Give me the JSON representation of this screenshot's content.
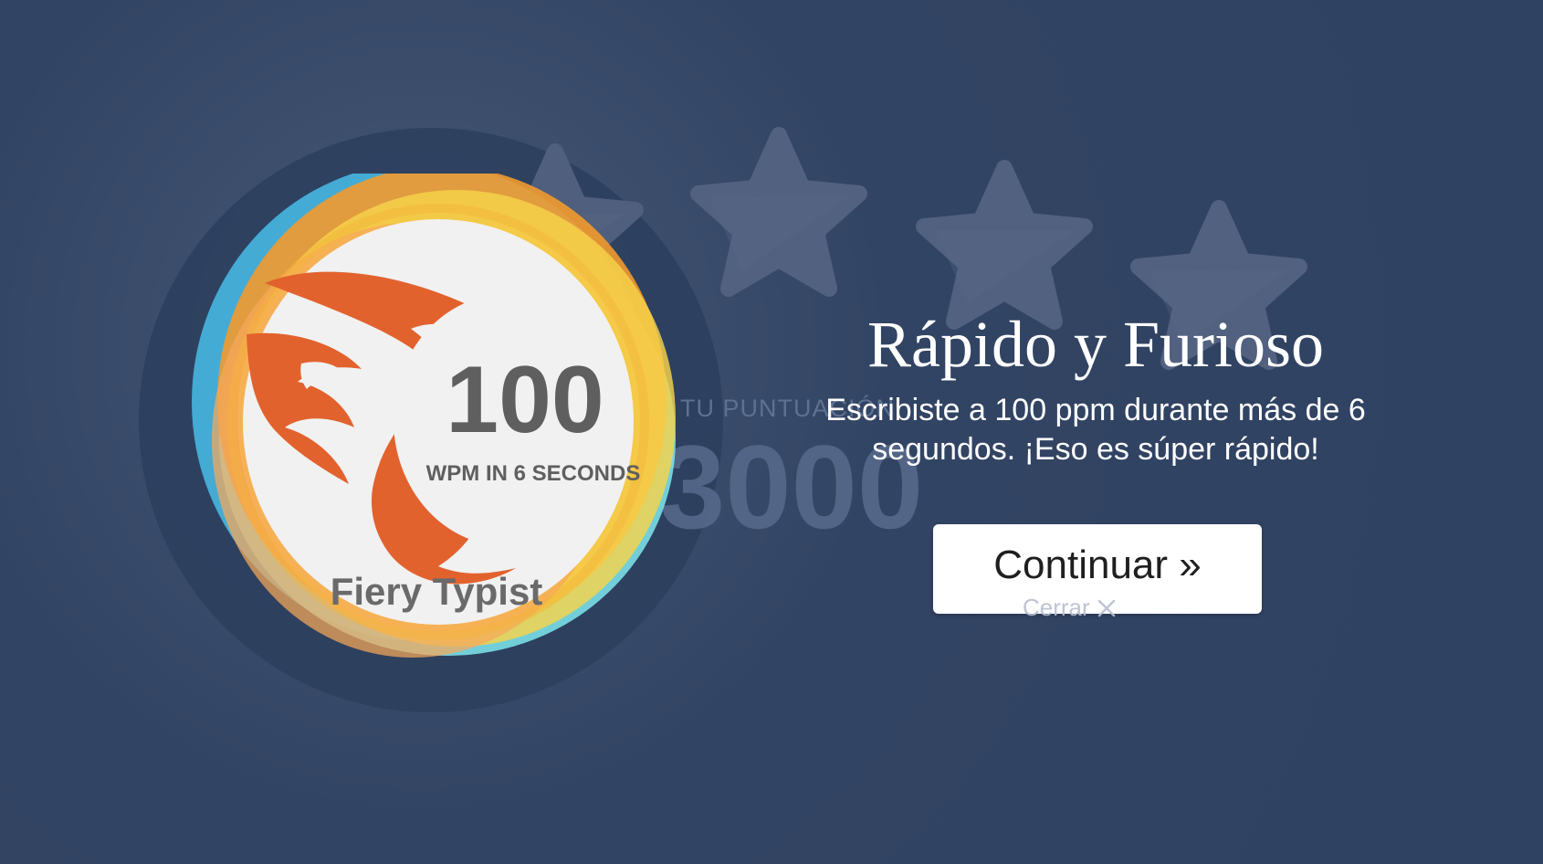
{
  "score": {
    "label": "TU PUNTUACIÓN",
    "value": "3000"
  },
  "badge": {
    "number": "100",
    "subtitle": "WPM IN 6 SECONDS",
    "name": "Fiery Typist",
    "icon": "flame-icon",
    "colors": {
      "flame": "#e2622e",
      "ring_orange": "#f29a2e",
      "ring_yellow": "#f7d34a",
      "ring_blue": "#46b4e0",
      "ring_cyan": "#7fe9ef",
      "center": "#f1f1f1",
      "number": "#5f5f5f"
    }
  },
  "stars": {
    "icon": "star-icon",
    "count": 4,
    "filled": 0,
    "color": "#52617f"
  },
  "achievement": {
    "title": "Rápido y Furioso",
    "description": "Escribiste a 100 ppm durante más de 6 segundos. ¡Eso es súper rápido!"
  },
  "actions": {
    "continue_label": "Continuar »",
    "close_label": "Cerrar"
  },
  "theme": {
    "background": "#324463",
    "text": "#ffffff"
  }
}
